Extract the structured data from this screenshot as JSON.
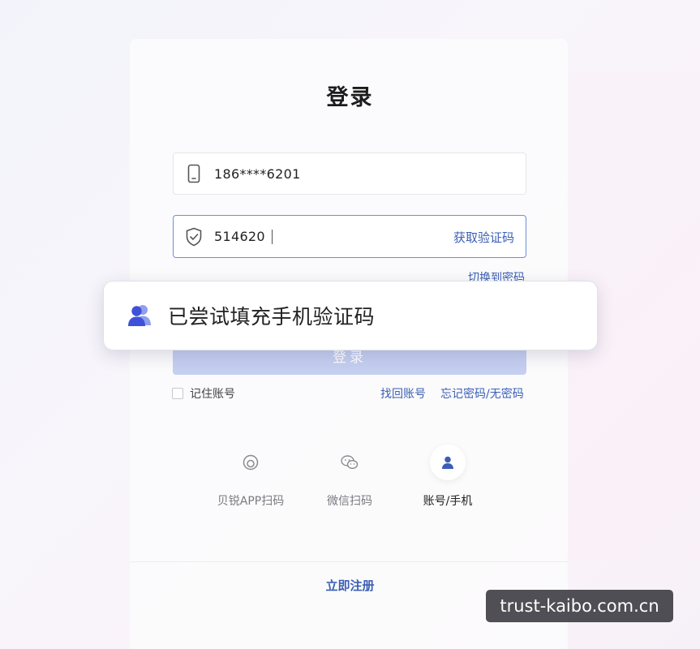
{
  "title": "登录",
  "phone_field": {
    "value": "186****6201",
    "icon": "phone-icon"
  },
  "code_field": {
    "value": "514620",
    "icon": "shield-check-icon",
    "action": "获取验证码"
  },
  "switch_link": "切换到密码",
  "login_button": "登录",
  "remember_label": "记住账号",
  "recover_link": "找回账号",
  "forgot_link": "忘记密码/无密码",
  "methods": [
    {
      "label": "贝锐APP扫码",
      "icon": "app-scan-icon",
      "active": false
    },
    {
      "label": "微信扫码",
      "icon": "wechat-icon",
      "active": false
    },
    {
      "label": "账号/手机",
      "icon": "user-icon",
      "active": true
    }
  ],
  "register_link": "立即注册",
  "toast": {
    "text": "已尝试填充手机验证码",
    "icon": "contacts-icon"
  },
  "watermark": "trust-kaibo.com.cn",
  "colors": {
    "accent": "#3a5fb5",
    "button_disabled": "#c5cff0",
    "focus_border": "#6f8fd6"
  }
}
